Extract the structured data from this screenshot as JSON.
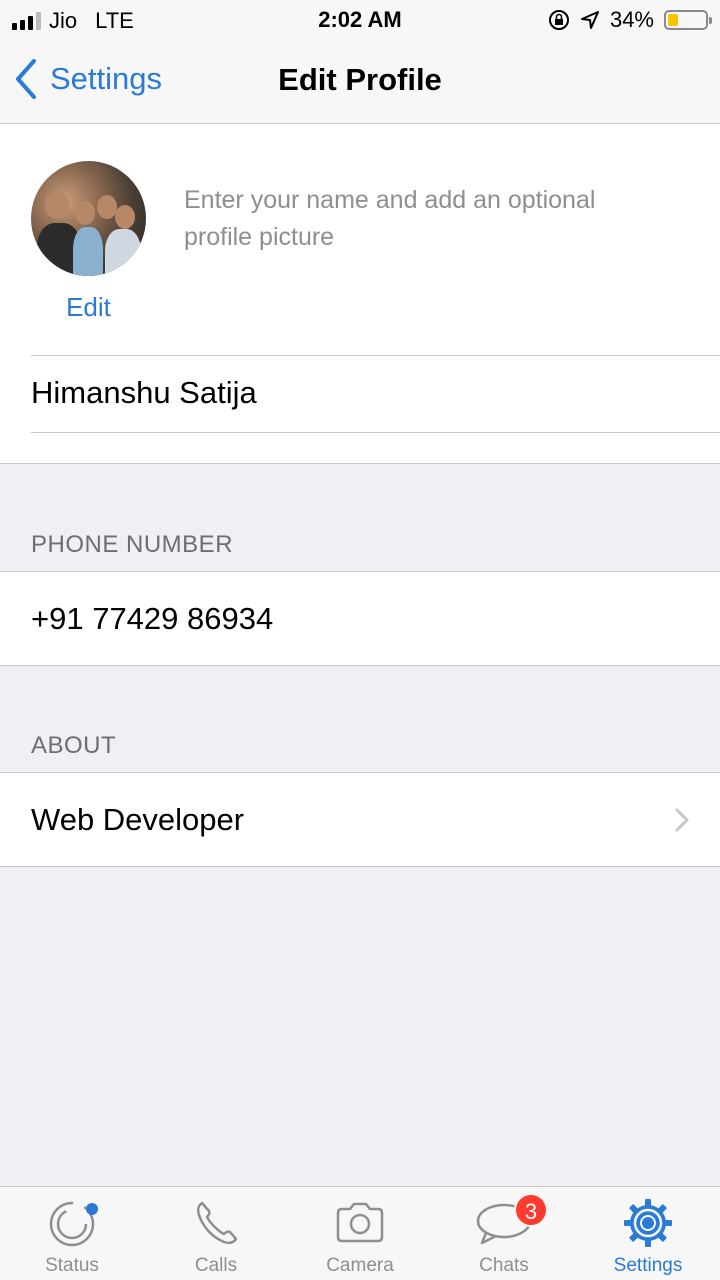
{
  "status_bar": {
    "carrier": "Jio",
    "network": "LTE",
    "time": "2:02 AM",
    "battery_percent_text": "34%",
    "battery_level": 0.34,
    "battery_color": "#f7c400"
  },
  "nav": {
    "back_label": "Settings",
    "title": "Edit Profile"
  },
  "profile": {
    "edit_label": "Edit",
    "hint": "Enter your name and add an optional profile picture",
    "name_value": "Himanshu Satija"
  },
  "phone": {
    "header": "PHONE NUMBER",
    "value": "+91 77429 86934"
  },
  "about": {
    "header": "ABOUT",
    "value": "Web Developer"
  },
  "tabs": [
    {
      "label": "Status",
      "icon": "status-icon"
    },
    {
      "label": "Calls",
      "icon": "phone-icon"
    },
    {
      "label": "Camera",
      "icon": "camera-icon"
    },
    {
      "label": "Chats",
      "icon": "chat-bubbles-icon",
      "badge": "3"
    },
    {
      "label": "Settings",
      "icon": "gear-icon",
      "active": true
    }
  ],
  "colors": {
    "accent": "#2a7ad6",
    "badge": "#ff3b30",
    "background": "#efeff4"
  }
}
